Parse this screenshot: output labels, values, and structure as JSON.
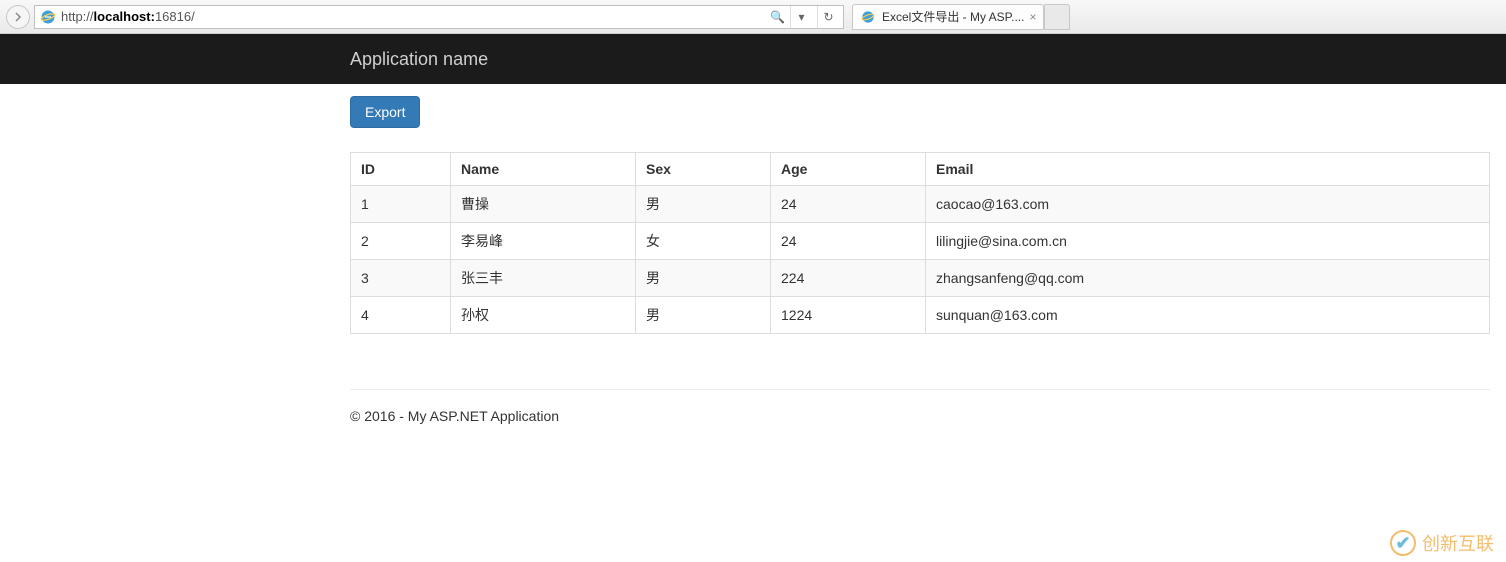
{
  "browser": {
    "url_prefix": "http://",
    "url_host": "localhost:",
    "url_port": "16816",
    "url_path": "/",
    "tab_title": "Excel文件导出 - My ASP....",
    "search_icon": "🔍",
    "refresh_icon": "↻",
    "dropdown_icon": "▾"
  },
  "navbar": {
    "brand": "Application name"
  },
  "buttons": {
    "export": "Export"
  },
  "table": {
    "headers": {
      "id": "ID",
      "name": "Name",
      "sex": "Sex",
      "age": "Age",
      "email": "Email"
    },
    "rows": [
      {
        "id": "1",
        "name": "曹操",
        "sex": "男",
        "age": "24",
        "email": "caocao@163.com"
      },
      {
        "id": "2",
        "name": "李易峰",
        "sex": "女",
        "age": "24",
        "email": "lilingjie@sina.com.cn"
      },
      {
        "id": "3",
        "name": "张三丰",
        "sex": "男",
        "age": "224",
        "email": "zhangsanfeng@qq.com"
      },
      {
        "id": "4",
        "name": "孙权",
        "sex": "男",
        "age": "1224",
        "email": "sunquan@163.com"
      }
    ]
  },
  "footer": {
    "text": "© 2016 - My ASP.NET Application"
  },
  "watermark": {
    "text": "创新互联"
  }
}
